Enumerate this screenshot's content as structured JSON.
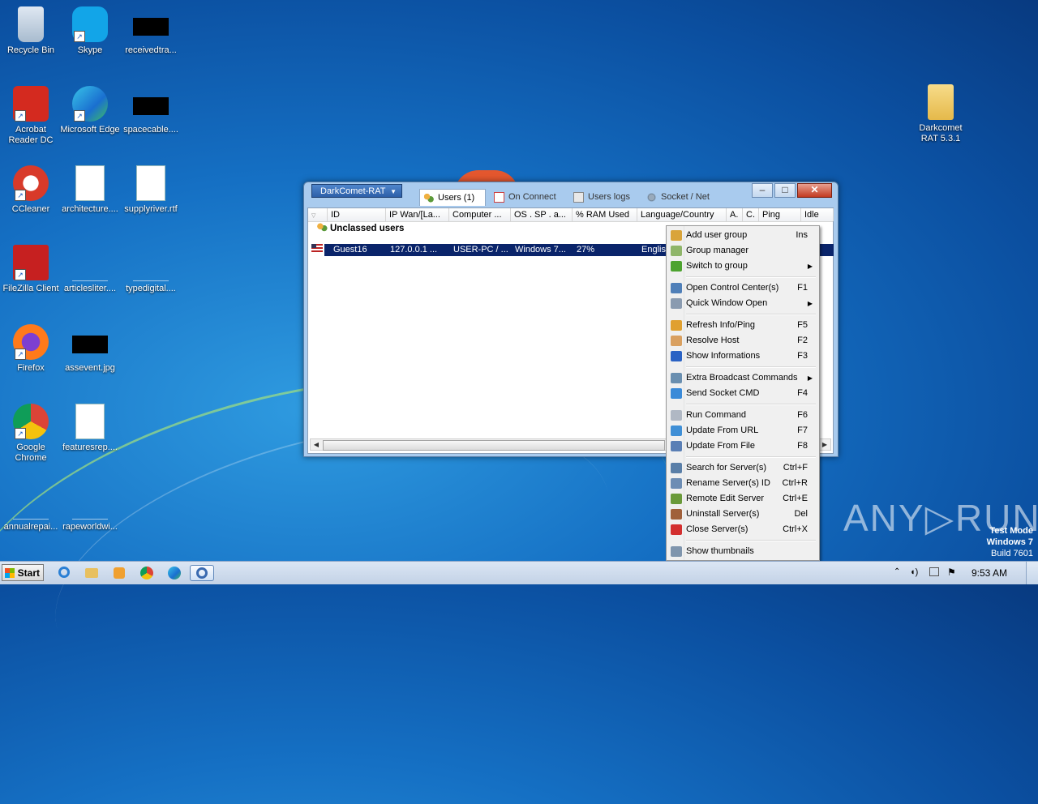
{
  "desktop": {
    "icons": [
      {
        "label": "Recycle Bin",
        "icon": "recycle-bin-icon"
      },
      {
        "label": "Skype",
        "icon": "skype-icon"
      },
      {
        "label": "receivedtra...",
        "icon": "black-thumbnail-icon"
      },
      {
        "label": "Acrobat Reader DC",
        "icon": "acrobat-icon"
      },
      {
        "label": "Microsoft Edge",
        "icon": "edge-icon"
      },
      {
        "label": "spacecable....",
        "icon": "black-thumbnail-icon"
      },
      {
        "label": "CCleaner",
        "icon": "ccleaner-icon"
      },
      {
        "label": "architecture....",
        "icon": "word-doc-icon"
      },
      {
        "label": "supplyriver.rtf",
        "icon": "word-doc-icon"
      },
      {
        "label": "FileZilla Client",
        "icon": "filezilla-icon"
      },
      {
        "label": "articlesliter....",
        "icon": "blank-file-icon"
      },
      {
        "label": "typedigital....",
        "icon": "blank-file-icon"
      },
      {
        "label": "Firefox",
        "icon": "firefox-icon"
      },
      {
        "label": "assevent.jpg",
        "icon": "black-thumbnail-icon"
      },
      {
        "label": "Google Chrome",
        "icon": "chrome-icon"
      },
      {
        "label": "featuresrep....",
        "icon": "word-doc-icon"
      },
      {
        "label": "annualrepai...",
        "icon": "blank-file-icon"
      },
      {
        "label": "rapeworldwi...",
        "icon": "blank-file-icon"
      },
      {
        "label": "Darkcomet RAT 5.3.1",
        "icon": "folder-icon"
      }
    ]
  },
  "window": {
    "menu_button": "DarkComet-RAT",
    "tabs": [
      {
        "label": "Users (1)",
        "active": true
      },
      {
        "label": "On Connect",
        "active": false
      },
      {
        "label": "Users logs",
        "active": false
      },
      {
        "label": "Socket / Net",
        "active": false
      }
    ],
    "caption_buttons": {
      "minimize": "–",
      "maximize": "□",
      "close": "✕"
    },
    "columns": [
      "ID",
      "IP Wan/[La...",
      "Computer ...",
      "OS . SP . a...",
      "% RAM Used",
      "Language/Country",
      "A.",
      "C.",
      "Ping",
      "Idle"
    ],
    "group_title": "Unclassed users",
    "rows": [
      {
        "id": "Guest16",
        "ip": "127.0.0.1 ...",
        "computer": "USER-PC / ...",
        "os": "Windows 7...",
        "ram": "27%",
        "language": "English"
      }
    ]
  },
  "context_menu": {
    "items": [
      {
        "label": "Add user group",
        "shortcut": "Ins",
        "icon": "users-icon",
        "color": "#d9a43a"
      },
      {
        "label": "Group manager",
        "shortcut": "",
        "icon": "grid-icon",
        "color": "#8fb56a"
      },
      {
        "label": "Switch to group",
        "shortcut": "",
        "submenu": true,
        "icon": "switch-icon",
        "color": "#4da32f"
      },
      {
        "sep": true
      },
      {
        "label": "Open Control Center(s)",
        "shortcut": "F1",
        "icon": "monitor-icon",
        "color": "#4f7fb8"
      },
      {
        "label": "Quick Window Open",
        "shortcut": "",
        "submenu": true,
        "icon": "window-icon",
        "color": "#8a9bb0"
      },
      {
        "sep": true
      },
      {
        "label": "Refresh Info/Ping",
        "shortcut": "F5",
        "icon": "refresh-icon",
        "color": "#e0a030"
      },
      {
        "label": "Resolve Host",
        "shortcut": "F2",
        "icon": "host-icon",
        "color": "#d9a060"
      },
      {
        "label": "Show Informations",
        "shortcut": "F3",
        "icon": "info-icon",
        "color": "#2a62c4"
      },
      {
        "sep": true
      },
      {
        "label": "Extra Broadcast Commands",
        "shortcut": "",
        "submenu": true,
        "icon": "broadcast-icon",
        "color": "#6a8fb0"
      },
      {
        "label": "Send Socket CMD",
        "shortcut": "F4",
        "icon": "arrow-icon",
        "color": "#3a8ad8"
      },
      {
        "sep": true
      },
      {
        "label": "Run Command",
        "shortcut": "F6",
        "icon": "run-icon",
        "color": "#b0b8c4"
      },
      {
        "label": "Update From URL",
        "shortcut": "F7",
        "icon": "download-icon",
        "color": "#3f8fd6"
      },
      {
        "label": "Update From File",
        "shortcut": "F8",
        "icon": "update-file-icon",
        "color": "#5a7fb5"
      },
      {
        "sep": true
      },
      {
        "label": "Search for Server(s)",
        "shortcut": "Ctrl+F",
        "icon": "search-icon",
        "color": "#5a7fa8"
      },
      {
        "label": "Rename Server(s) ID",
        "shortcut": "Ctrl+R",
        "icon": "rename-icon",
        "color": "#6d8db4"
      },
      {
        "label": "Remote Edit Server",
        "shortcut": "Ctrl+E",
        "icon": "gear-icon",
        "color": "#6a9a3a"
      },
      {
        "label": "Uninstall Server(s)",
        "shortcut": "Del",
        "icon": "uninstall-icon",
        "color": "#a0603a"
      },
      {
        "label": "Close Server(s)",
        "shortcut": "Ctrl+X",
        "icon": "close-circle-icon",
        "color": "#d32f2f"
      },
      {
        "sep": true
      },
      {
        "label": "Show thumbnails",
        "shortcut": "",
        "icon": "thumbnail-icon",
        "color": "#7f95ad"
      }
    ]
  },
  "watermark": {
    "brand": "ANY▷RUN",
    "test_mode": "Test Mode",
    "os": "Windows 7",
    "build": "Build 7601"
  },
  "taskbar": {
    "start_label": "Start",
    "pinned": [
      "ie-icon",
      "explorer-icon",
      "media-player-icon",
      "chrome-icon",
      "edge-icon",
      "darkcomet-icon"
    ],
    "clock": "9:53 AM"
  }
}
